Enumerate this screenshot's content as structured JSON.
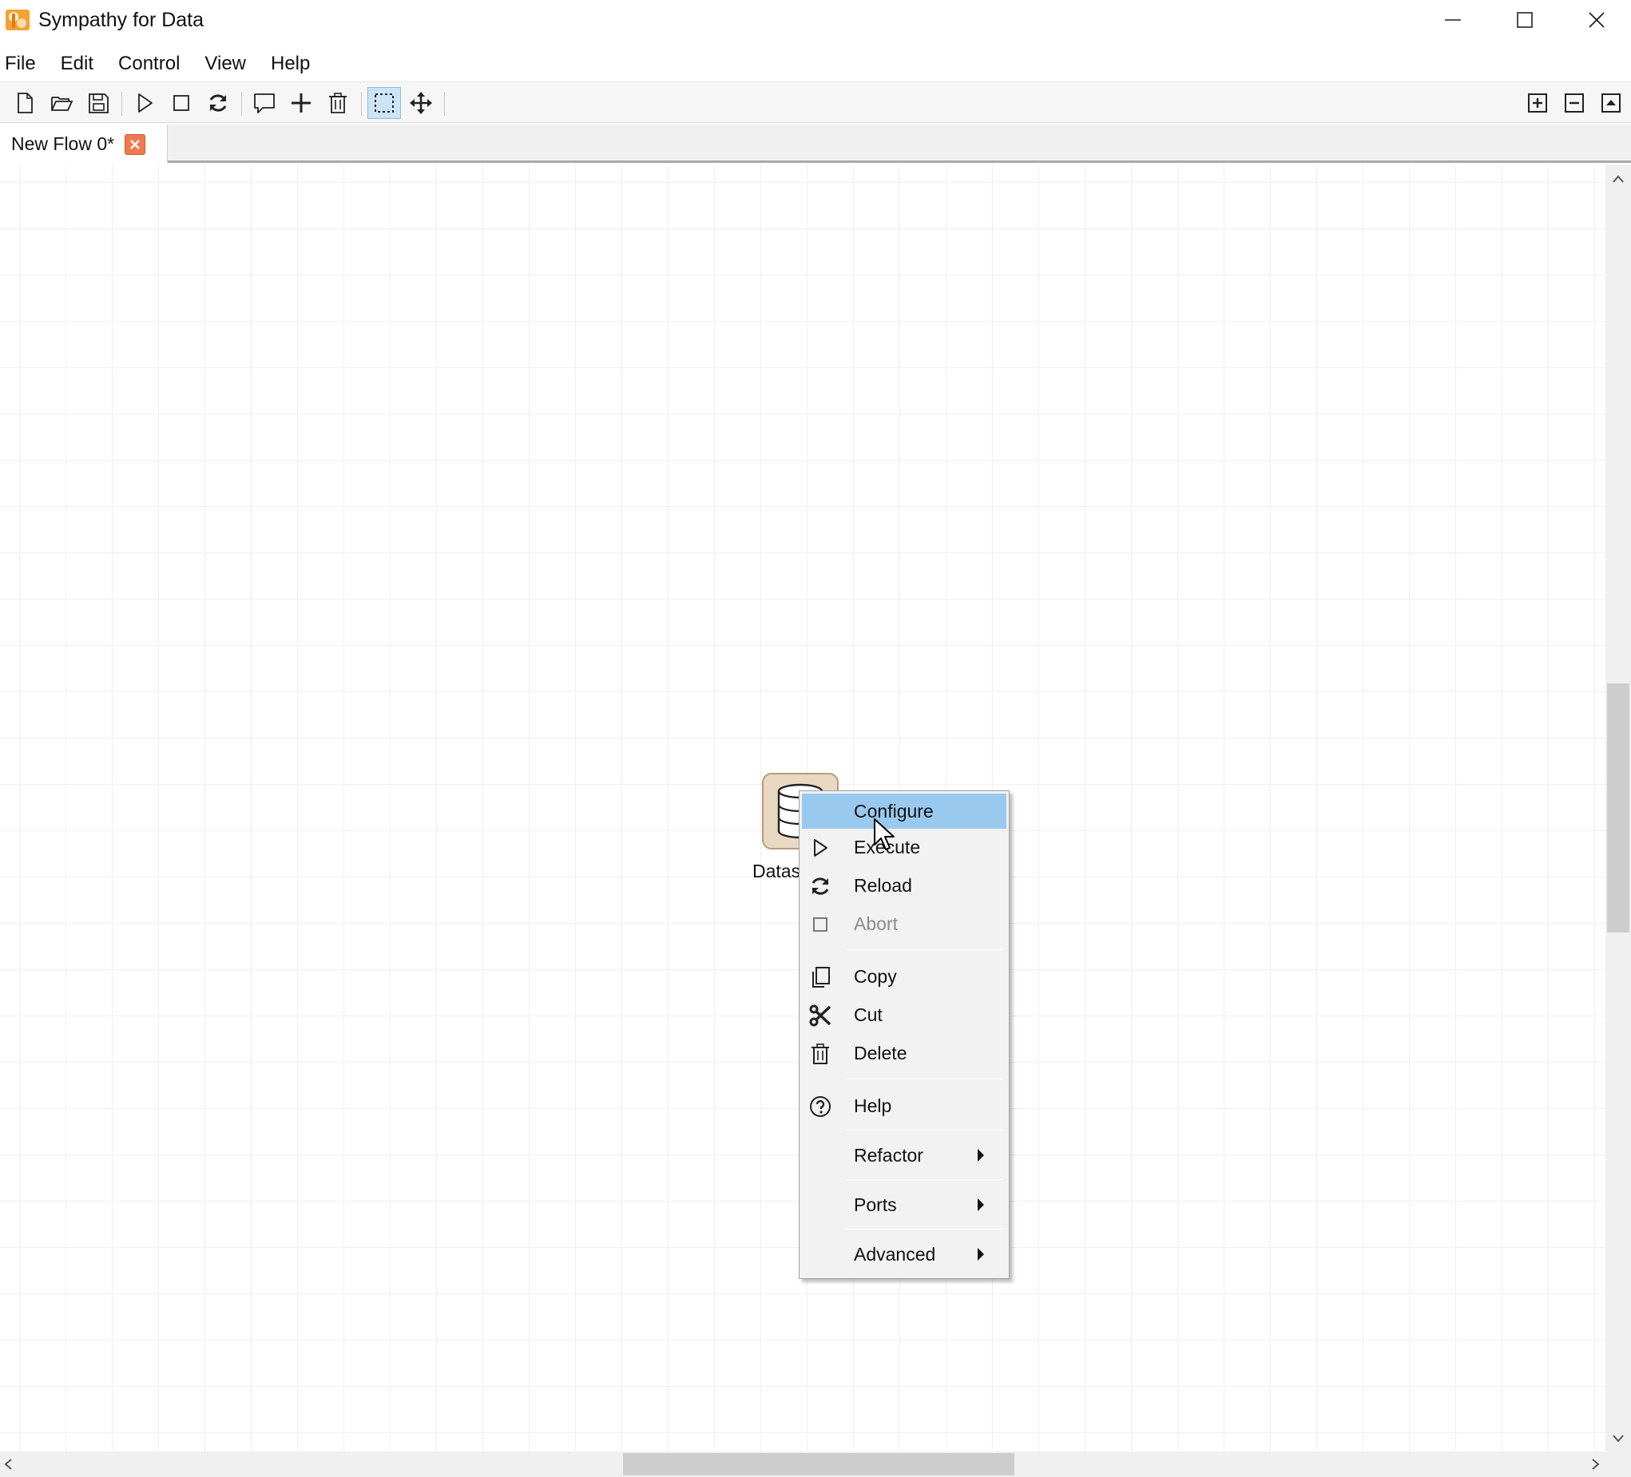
{
  "window": {
    "title": "Sympathy for Data",
    "controls": [
      "minimize-icon",
      "maximize-icon",
      "close-icon"
    ]
  },
  "menubar": {
    "items": [
      "File",
      "Edit",
      "Control",
      "View",
      "Help"
    ]
  },
  "toolbar": {
    "buttons": [
      "new-file-icon",
      "open-folder-icon",
      "save-icon",
      "execute-icon",
      "stop-icon",
      "reload-icon",
      "comment-icon",
      "add-icon",
      "delete-icon",
      "select-icon",
      "move-icon",
      "zoom-in-icon",
      "zoom-out-icon",
      "fit-icon"
    ],
    "active": "select-icon"
  },
  "tabs": [
    {
      "label": "New Flow 0*",
      "closable": true
    }
  ],
  "node": {
    "label": "Datas",
    "icon": "database-icon"
  },
  "context_menu": {
    "items": [
      {
        "label": "Configure",
        "icon": "",
        "highlighted": true
      },
      {
        "label": "Execute",
        "icon": "play-icon"
      },
      {
        "label": "Reload",
        "icon": "reload-icon"
      },
      {
        "label": "Abort",
        "icon": "stop-icon",
        "disabled": true
      },
      {
        "label": "Copy",
        "icon": "copy-icon"
      },
      {
        "label": "Cut",
        "icon": "scissors-icon"
      },
      {
        "label": "Delete",
        "icon": "trash-icon"
      },
      {
        "label": "Help",
        "icon": "help-icon"
      },
      {
        "label": "Refactor",
        "submenu": true
      },
      {
        "label": "Ports",
        "submenu": true
      },
      {
        "label": "Advanced",
        "submenu": true
      }
    ]
  },
  "colors": {
    "highlight": "#99c9ef",
    "tab_close": "#ef7a50",
    "node_fill": "#e8d8c2"
  }
}
